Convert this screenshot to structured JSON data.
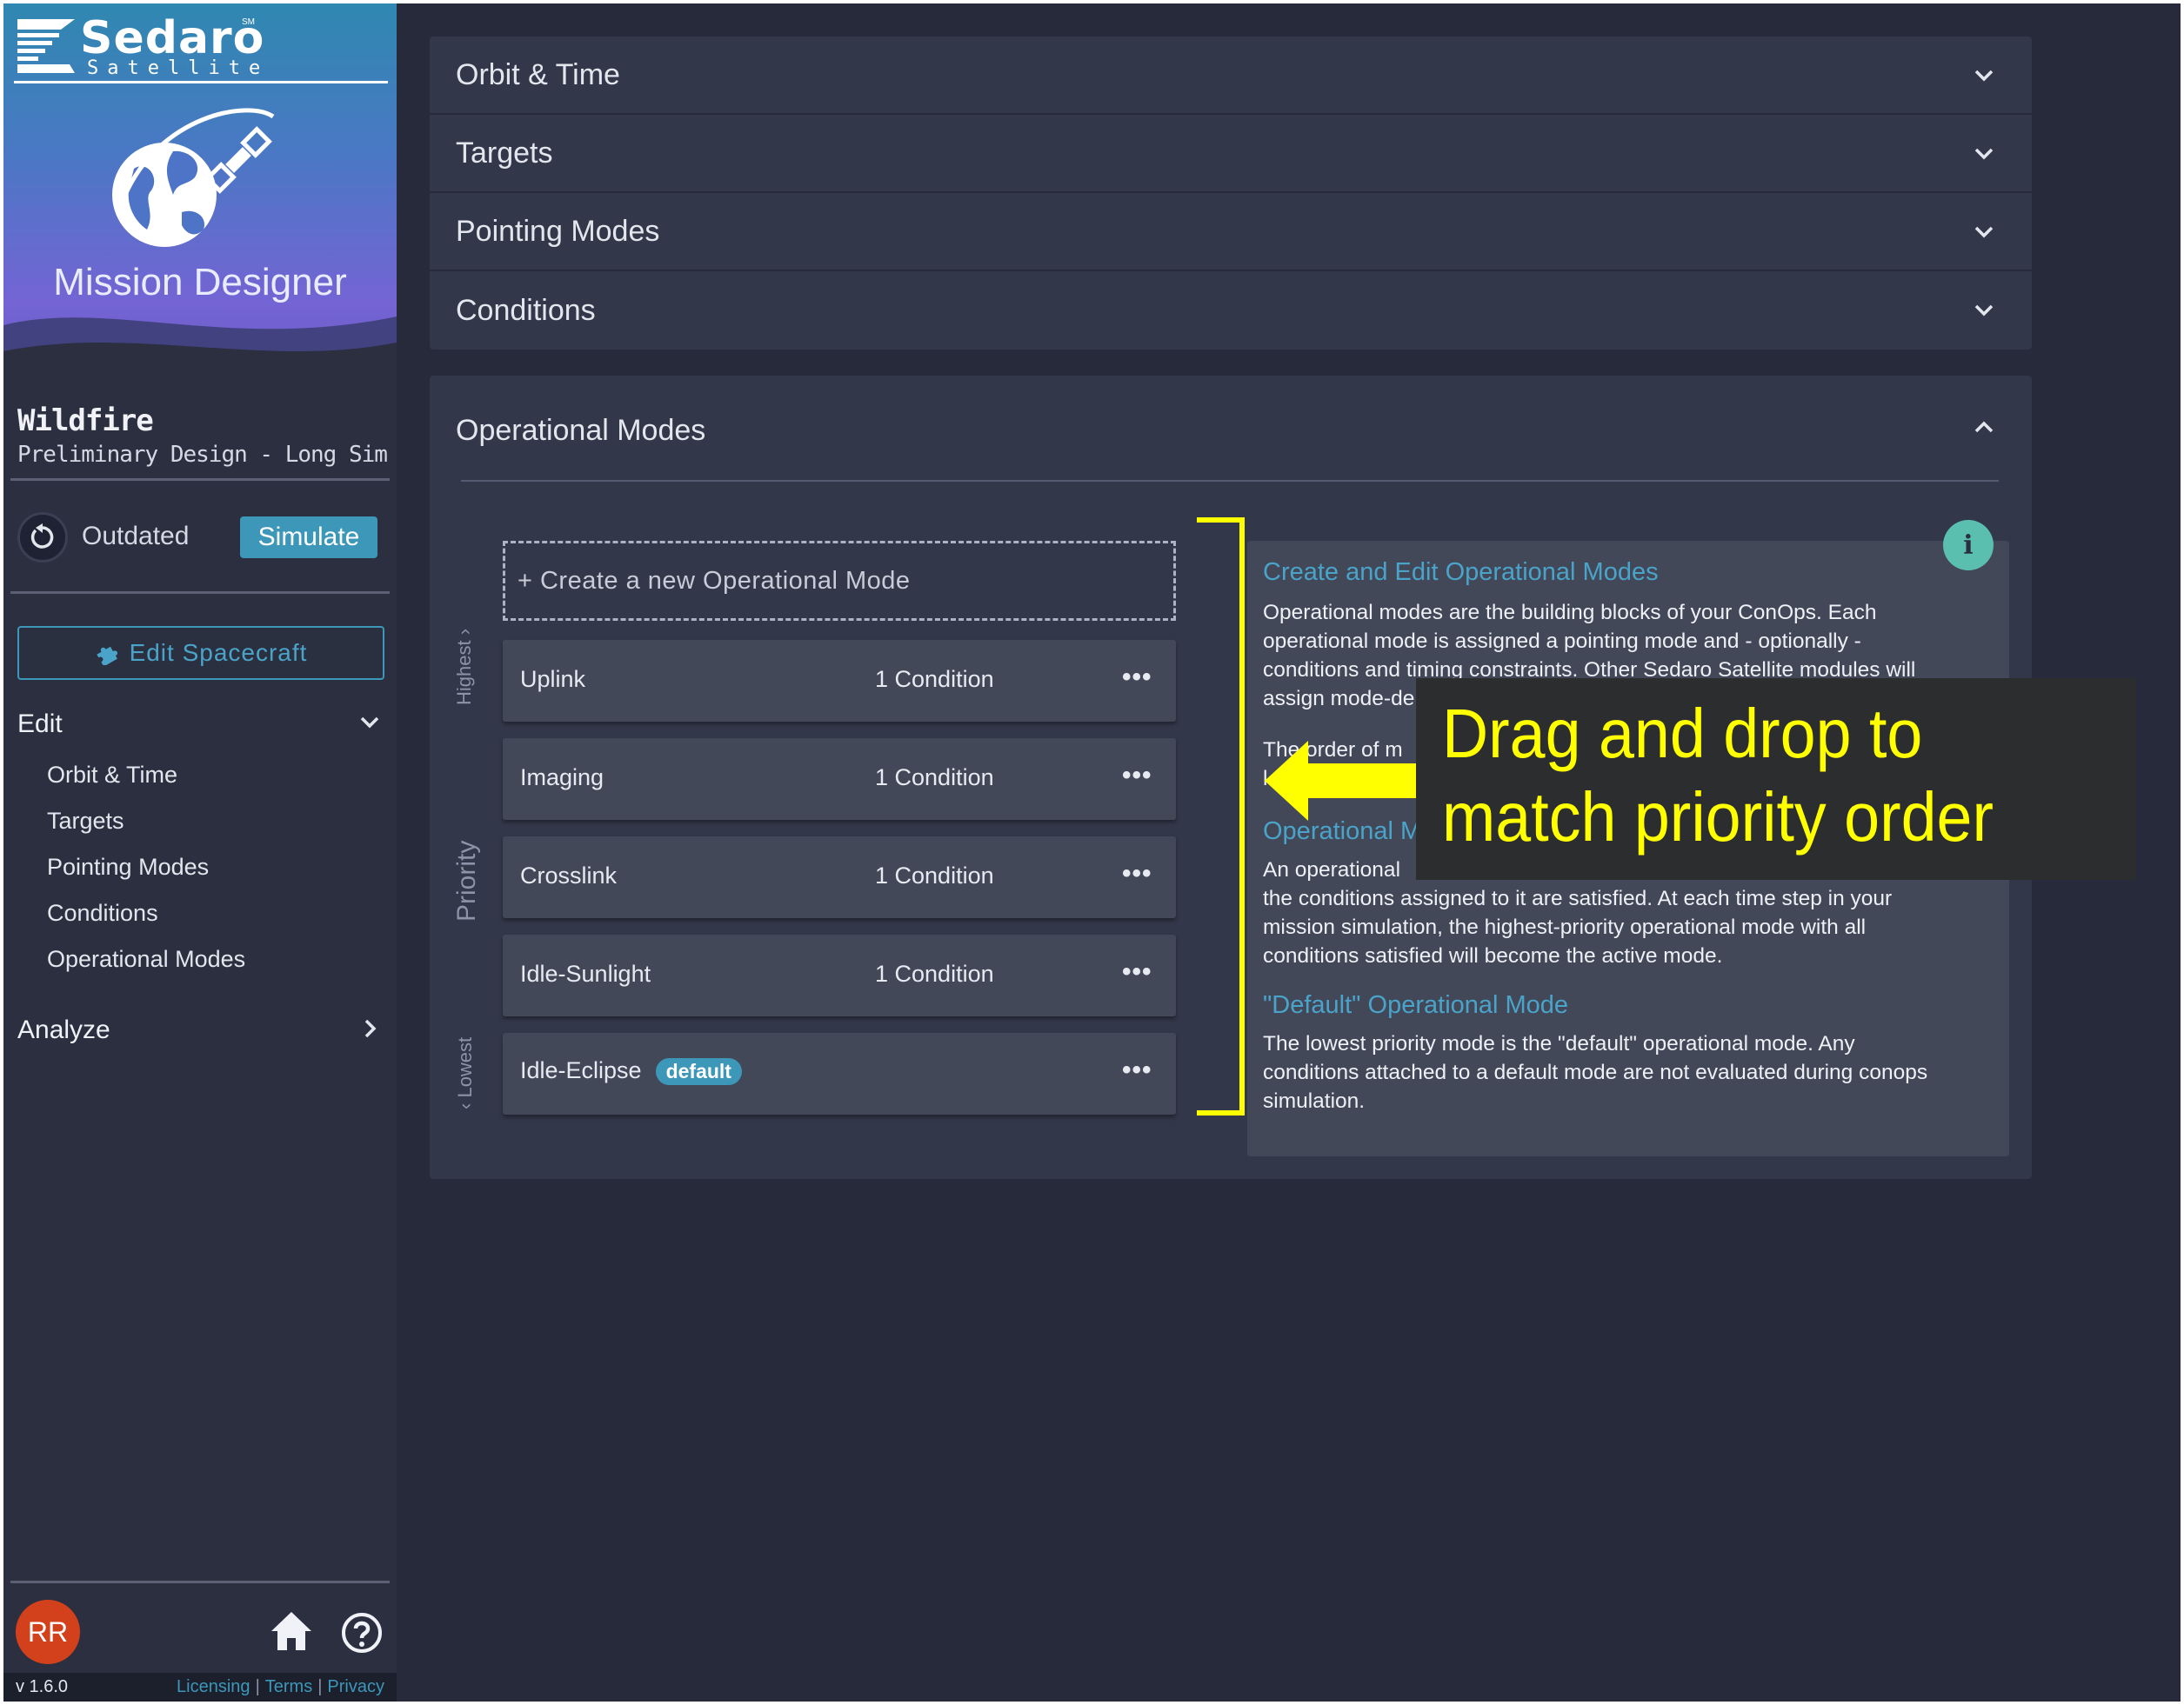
{
  "brand": {
    "logo_word": "Sedaro",
    "logo_sub": "Satellite",
    "logo_mark": "SM",
    "app_title": "Mission Designer"
  },
  "project": {
    "name": "Wildfire",
    "subtitle": "Preliminary Design - Long Sim"
  },
  "status": {
    "label": "Outdated",
    "simulate_label": "Simulate"
  },
  "edit_spacecraft_label": "Edit Spacecraft",
  "nav": {
    "edit_label": "Edit",
    "items": [
      "Orbit & Time",
      "Targets",
      "Pointing Modes",
      "Conditions",
      "Operational Modes"
    ],
    "analyze_label": "Analyze"
  },
  "user": {
    "initials": "RR"
  },
  "footer": {
    "version": "v 1.6.0",
    "links": [
      "Licensing",
      "Terms",
      "Privacy"
    ]
  },
  "accordion": [
    {
      "label": "Orbit & Time"
    },
    {
      "label": "Targets"
    },
    {
      "label": "Pointing Modes"
    },
    {
      "label": "Conditions"
    }
  ],
  "operational_modes": {
    "title": "Operational Modes",
    "create_label": "+ Create a new Operational Mode",
    "priority_label": "Priority",
    "highest_label": "Highest",
    "lowest_label": "Lowest",
    "modes": [
      {
        "name": "Uplink",
        "conditions": "1 Condition"
      },
      {
        "name": "Imaging",
        "conditions": "1 Condition"
      },
      {
        "name": "Crosslink",
        "conditions": "1 Condition"
      },
      {
        "name": "Idle-Sunlight",
        "conditions": "1 Condition"
      },
      {
        "name": "Idle-Eclipse",
        "badge": "default"
      }
    ],
    "menu_glyph": "•••"
  },
  "info": {
    "icon_glyph": "i",
    "heading1": "Create and Edit Operational Modes",
    "para1_lines": [
      "Operational modes are the building blocks of your ConOps. Each",
      "operational mode is assigned a pointing mode and - optionally -",
      "conditions and timing constraints. Other Sedaro Satellite modules will",
      "assign mode-de"
    ],
    "para2_lines": [
      "The order of m",
      "l"
    ],
    "heading2": "Operational Mo",
    "para3_lines": [
      "An operational",
      "the conditions assigned to it are satisfied. At each time step in your",
      "mission simulation, the highest-priority operational mode with all",
      "conditions satisfied will become the active mode."
    ],
    "heading3": "\"Default\" Operational Mode",
    "para4_lines": [
      "The lowest priority mode is the \"default\" operational mode. Any",
      "conditions attached to a default mode are not evaluated during conops",
      "simulation."
    ]
  },
  "callout": {
    "line1": "Drag and drop to",
    "line2": "match priority order",
    "color": "#ffff00"
  },
  "colors": {
    "accent": "#3c97b8",
    "avatar": "#d2401c",
    "info_icon": "#5bbfb0",
    "background": "#262a3a"
  }
}
